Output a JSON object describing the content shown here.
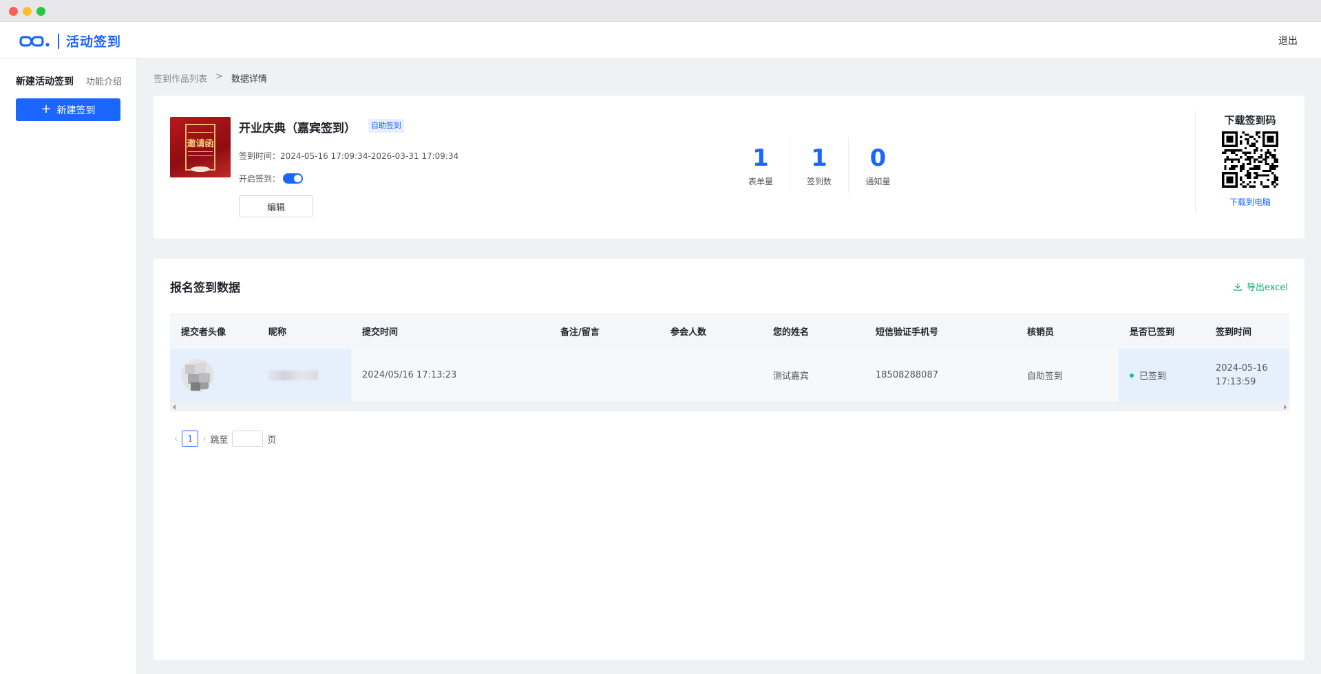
{
  "app": {
    "title": "活动签到",
    "logout": "退出"
  },
  "sidebar": {
    "tab_active": "新建活动签到",
    "tab_intro": "功能介绍",
    "new_button": "新建签到"
  },
  "breadcrumb": {
    "parent": "签到作品列表",
    "separator": ">",
    "current": "数据详情"
  },
  "event": {
    "poster_text": "邀请函",
    "title": "开业庆典（嘉宾签到）",
    "badge": "自助签到",
    "time": "签到时间：2024-05-16 17:09:34-2026-03-31 17:09:34",
    "toggle_label": "开启签到：",
    "toggle_on": true,
    "edit_button": "编辑"
  },
  "stats": [
    {
      "value": "1",
      "label": "表单量"
    },
    {
      "value": "1",
      "label": "签到数"
    },
    {
      "value": "0",
      "label": "通知量"
    }
  ],
  "qr": {
    "title": "下载签到码",
    "download": "下载到电脑"
  },
  "data_section": {
    "title": "报名签到数据",
    "export": "导出excel"
  },
  "table": {
    "headers": [
      "提交者头像",
      "昵称",
      "提交时间",
      "备注/留言",
      "参会人数",
      "您的姓名",
      "短信验证手机号",
      "核销员",
      "是否已签到",
      "签到时间"
    ],
    "rows": [
      {
        "submit_time": "2024/05/16 17:13:23",
        "remark": "",
        "attendees": "",
        "name": "测试嘉宾",
        "phone": "18508288087",
        "verifier": "自助签到",
        "signed": "已签到",
        "sign_date": "2024-05-16",
        "sign_clock": "17:13:59"
      }
    ]
  },
  "pager": {
    "page": "1",
    "jump_label": "跳至",
    "page_unit": "页"
  },
  "colors": {
    "primary": "#1a66ff",
    "export_green": "#17a872",
    "signed_dot": "#13c2a3"
  }
}
